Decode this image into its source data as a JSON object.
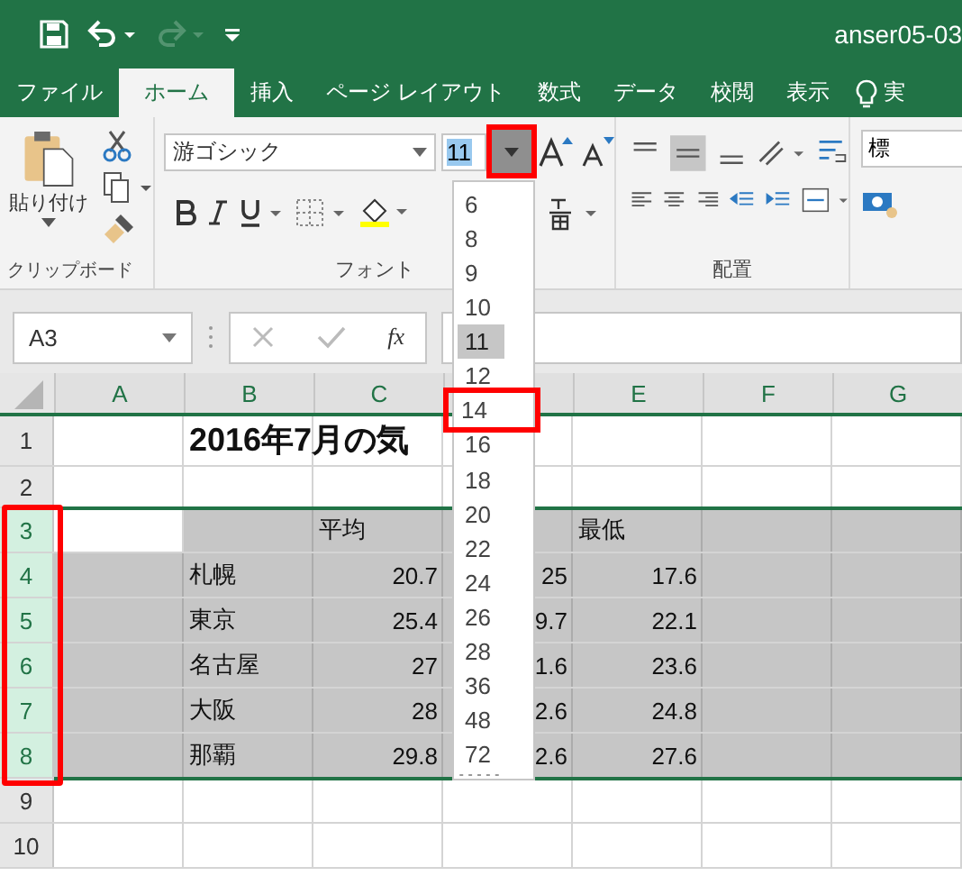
{
  "title_bar": {
    "title": "anser05-03",
    "redo_disabled": true
  },
  "tabs": [
    {
      "label": "ファイル",
      "selected": false
    },
    {
      "label": "ホーム",
      "selected": true
    },
    {
      "label": "挿入",
      "selected": false
    },
    {
      "label": "ページ レイアウト",
      "selected": false
    },
    {
      "label": "数式",
      "selected": false
    },
    {
      "label": "データ",
      "selected": false
    },
    {
      "label": "校閲",
      "selected": false
    },
    {
      "label": "表示",
      "selected": false
    }
  ],
  "tell_me": {
    "label": "実"
  },
  "ribbon": {
    "clipboard": {
      "paste_label": "貼り付け",
      "label": "クリップボード"
    },
    "font": {
      "font_name": "游ゴシック",
      "font_size": "11",
      "size_button_marked": true,
      "label": "フォント"
    },
    "alignment": {
      "label": "配置"
    },
    "number": {
      "format": "標"
    }
  },
  "formula_bar": {
    "name_box": "A3",
    "fx": "fx"
  },
  "font_size_list": {
    "items": [
      {
        "label": "6",
        "selected": false,
        "marked": false
      },
      {
        "label": "8",
        "selected": false,
        "marked": false
      },
      {
        "label": "9",
        "selected": false,
        "marked": false
      },
      {
        "label": "10",
        "selected": false,
        "marked": false
      },
      {
        "label": "11",
        "selected": true,
        "marked": false
      },
      {
        "label": "12",
        "selected": false,
        "marked": false
      },
      {
        "label": "14",
        "selected": false,
        "marked": true
      },
      {
        "label": "16",
        "selected": false,
        "marked": false
      },
      {
        "label": "18",
        "selected": false,
        "marked": false
      },
      {
        "label": "20",
        "selected": false,
        "marked": false
      },
      {
        "label": "22",
        "selected": false,
        "marked": false
      },
      {
        "label": "24",
        "selected": false,
        "marked": false
      },
      {
        "label": "26",
        "selected": false,
        "marked": false
      },
      {
        "label": "28",
        "selected": false,
        "marked": false
      },
      {
        "label": "36",
        "selected": false,
        "marked": false
      },
      {
        "label": "48",
        "selected": false,
        "marked": false
      },
      {
        "label": "72",
        "selected": false,
        "marked": false
      }
    ]
  },
  "sheet": {
    "columns": [
      "A",
      "B",
      "C",
      null,
      "E",
      "F",
      "G"
    ],
    "rows": [
      {
        "number": "1",
        "kind": "title",
        "selected": false,
        "marked": false,
        "active": false,
        "cells": [
          null,
          "2016年7月の気",
          null,
          null,
          null,
          null,
          null
        ]
      },
      {
        "number": "2",
        "kind": "blank",
        "selected": false,
        "marked": false,
        "active": false
      },
      {
        "number": "3",
        "kind": "header",
        "selected": true,
        "marked": true,
        "active": true,
        "cells": [
          null,
          null,
          "平均",
          null,
          "最低",
          null,
          null
        ]
      },
      {
        "number": "4",
        "kind": "data",
        "selected": true,
        "marked": true,
        "active": false,
        "cells": [
          null,
          "札幌",
          "20.7",
          "25",
          "17.6",
          null,
          null
        ]
      },
      {
        "number": "5",
        "kind": "data",
        "selected": true,
        "marked": true,
        "active": false,
        "cells": [
          null,
          "東京",
          "25.4",
          "9.7",
          "22.1",
          null,
          null
        ]
      },
      {
        "number": "6",
        "kind": "data",
        "selected": true,
        "marked": true,
        "active": false,
        "cells": [
          null,
          "名古屋",
          "27",
          "1.6",
          "23.6",
          null,
          null
        ]
      },
      {
        "number": "7",
        "kind": "data",
        "selected": true,
        "marked": true,
        "active": false,
        "cells": [
          null,
          "大阪",
          "28",
          "2.6",
          "24.8",
          null,
          null
        ]
      },
      {
        "number": "8",
        "kind": "data",
        "selected": true,
        "marked": true,
        "active": false,
        "cells": [
          null,
          "那覇",
          "29.8",
          "2.6",
          "27.6",
          null,
          null
        ]
      },
      {
        "number": "9",
        "kind": "blank",
        "selected": false,
        "marked": false,
        "active": false
      },
      {
        "number": "10",
        "kind": "blank",
        "selected": false,
        "marked": false,
        "active": false
      }
    ]
  }
}
